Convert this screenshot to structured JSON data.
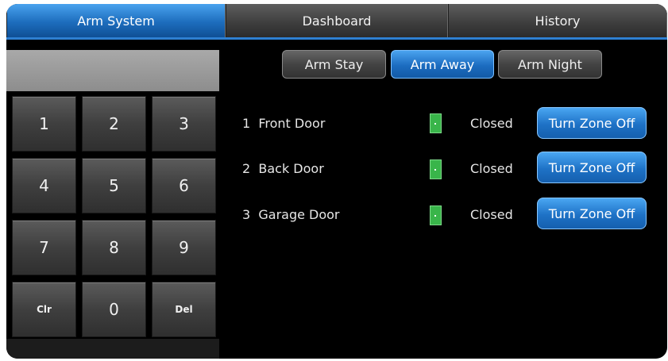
{
  "tabs": [
    {
      "label": "Arm System",
      "active": true
    },
    {
      "label": "Dashboard",
      "active": false
    },
    {
      "label": "History",
      "active": false
    }
  ],
  "keypad": {
    "display_value": "",
    "keys": [
      "1",
      "2",
      "3",
      "4",
      "5",
      "6",
      "7",
      "8",
      "9",
      "Clr",
      "0",
      "Del"
    ]
  },
  "modes": [
    {
      "label": "Arm Stay",
      "active": false
    },
    {
      "label": "Arm Away",
      "active": true
    },
    {
      "label": "Arm Night",
      "active": false
    }
  ],
  "zones": [
    {
      "number": "1",
      "name": "Front Door",
      "status": "Closed",
      "action": "Turn Zone Off"
    },
    {
      "number": "2",
      "name": "Back Door",
      "status": "Closed",
      "action": "Turn Zone Off"
    },
    {
      "number": "3",
      "name": "Garage Door",
      "status": "Closed",
      "action": "Turn Zone Off"
    }
  ],
  "colors": {
    "accent": "#1e72c6",
    "zone_ok": "#39b54a",
    "background": "#000000"
  }
}
